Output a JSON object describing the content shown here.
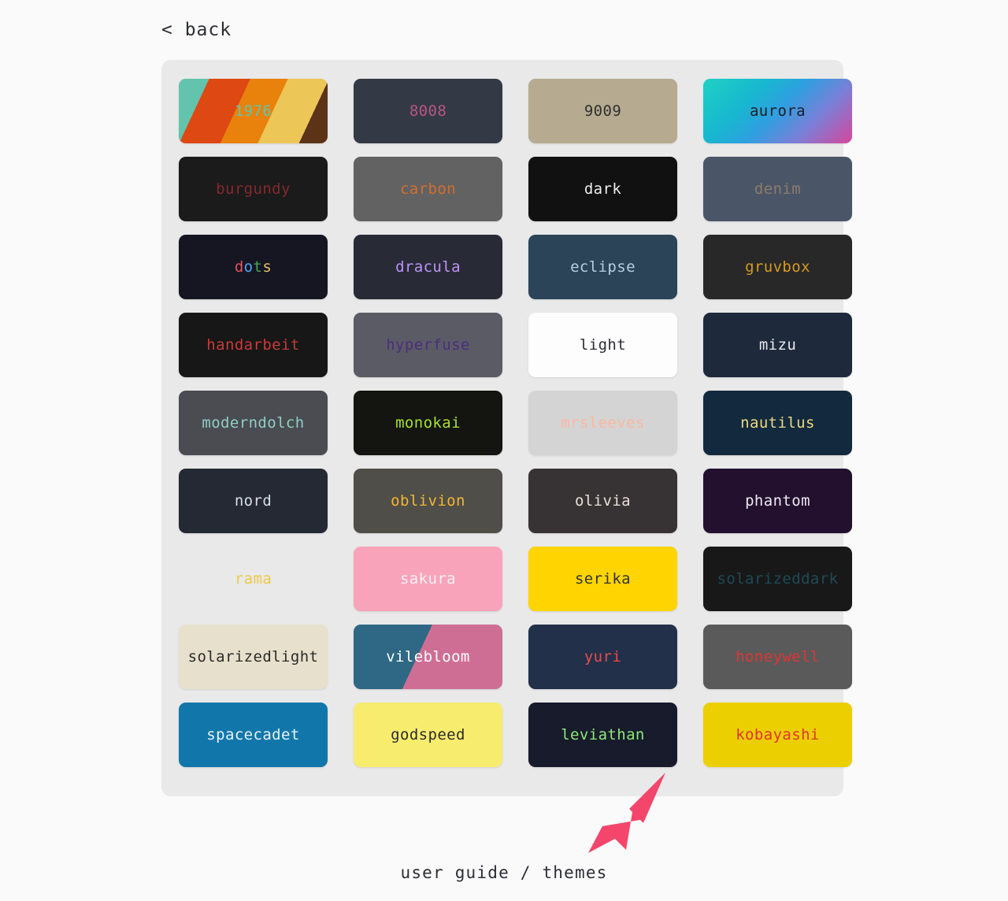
{
  "page": {
    "background_color": "#fafafa",
    "back_label": "< back",
    "footer_caption": "user guide / themes",
    "panel_color": "#e9e9e9",
    "arrow_color": "#f4466b"
  },
  "themes": [
    {
      "name": "1976",
      "bg": "#dd4813",
      "fg": "#62c4ac",
      "style": "stripes-1976"
    },
    {
      "name": "8008",
      "bg": "#333a45",
      "fg": "#b85683",
      "style": "solid"
    },
    {
      "name": "9009",
      "bg": "#b6ab91",
      "fg": "#303030",
      "style": "solid"
    },
    {
      "name": "aurora",
      "bg": "#1fd1c4",
      "fg": "#161d2b",
      "style": "gradient-aurora"
    },
    {
      "name": "burgundy",
      "bg": "#1b1b1b",
      "fg": "#85282d",
      "style": "solid"
    },
    {
      "name": "carbon",
      "bg": "#626262",
      "fg": "#d36e2d",
      "style": "solid"
    },
    {
      "name": "dark",
      "bg": "#111111",
      "fg": "#eeeeee",
      "style": "solid"
    },
    {
      "name": "denim",
      "bg": "#4a5568",
      "fg": "#8d7b68",
      "style": "solid"
    },
    {
      "name": "dots",
      "bg": "#161622",
      "fg": "#dddddd",
      "style": "multicolor-dots"
    },
    {
      "name": "dracula",
      "bg": "#282a36",
      "fg": "#bd93f9",
      "style": "solid"
    },
    {
      "name": "eclipse",
      "bg": "#2b4458",
      "fg": "#b6cee3",
      "style": "solid"
    },
    {
      "name": "gruvbox",
      "bg": "#282828",
      "fg": "#d79921",
      "style": "solid"
    },
    {
      "name": "handarbeit",
      "bg": "#171717",
      "fg": "#c83a3a",
      "style": "solid"
    },
    {
      "name": "hyperfuse",
      "bg": "#5b5b66",
      "fg": "#4b2d7f",
      "style": "solid"
    },
    {
      "name": "light",
      "bg": "#fdfdfd",
      "fg": "#2c2e34",
      "style": "solid"
    },
    {
      "name": "mizu",
      "bg": "#1e293b",
      "fg": "#e7eaee",
      "style": "solid"
    },
    {
      "name": "moderndolch",
      "bg": "#4b4b52",
      "fg": "#8fd0c2",
      "style": "solid"
    },
    {
      "name": "monokai",
      "bg": "#141411",
      "fg": "#a6e22e",
      "style": "solid"
    },
    {
      "name": "mrsleeves",
      "bg": "#d4d4d4",
      "fg": "#f9b8a1",
      "style": "solid"
    },
    {
      "name": "nautilus",
      "bg": "#13293d",
      "fg": "#ecd980",
      "style": "solid"
    },
    {
      "name": "nord",
      "bg": "#242933",
      "fg": "#d8dee9",
      "style": "solid"
    },
    {
      "name": "oblivion",
      "bg": "#4f4e49",
      "fg": "#f2b632",
      "style": "solid"
    },
    {
      "name": "olivia",
      "bg": "#373233",
      "fg": "#e8e0d8",
      "style": "solid"
    },
    {
      "name": "phantom",
      "bg": "#22102e",
      "fg": "#ede8ef",
      "style": "solid"
    },
    {
      "name": "rama",
      "bg": "#e9e9e9",
      "fg": "#ecc94b",
      "style": "flat"
    },
    {
      "name": "sakura",
      "bg": "#f9a3bb",
      "fg": "#fdf0f3",
      "style": "solid"
    },
    {
      "name": "serika",
      "bg": "#ffd400",
      "fg": "#333333",
      "style": "solid"
    },
    {
      "name": "solarizeddark",
      "bg": "#181818",
      "fg": "#1f4a55",
      "style": "solid"
    },
    {
      "name": "solarizedlight",
      "bg": "#e7e0cc",
      "fg": "#2b2b2b",
      "style": "solid"
    },
    {
      "name": "vilebloom",
      "bg": "#2e6884",
      "fg": "#ffffff",
      "style": "split-vilebloom"
    },
    {
      "name": "yuri",
      "bg": "#22304a",
      "fg": "#e84b4b",
      "style": "solid"
    },
    {
      "name": "honeywell",
      "bg": "#5a5a5a",
      "fg": "#e03535",
      "style": "solid"
    },
    {
      "name": "spacecadet",
      "bg": "#1177ab",
      "fg": "#e9f2f7",
      "style": "solid"
    },
    {
      "name": "godspeed",
      "bg": "#f7ec6d",
      "fg": "#2b2b2b",
      "style": "solid"
    },
    {
      "name": "leviathan",
      "bg": "#171b2b",
      "fg": "#8ee87a",
      "style": "solid"
    },
    {
      "name": "kobayashi",
      "bg": "#eccf00",
      "fg": "#e0342a",
      "style": "solid"
    }
  ],
  "dots_letters": [
    {
      "char": "d",
      "color": "#e05561"
    },
    {
      "char": "o",
      "color": "#4aa5f0"
    },
    {
      "char": "t",
      "color": "#46a758"
    },
    {
      "char": "s",
      "color": "#e3c567"
    }
  ]
}
